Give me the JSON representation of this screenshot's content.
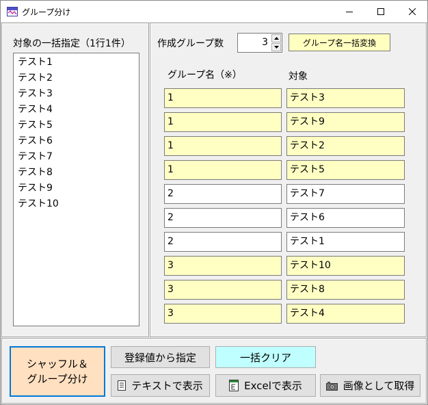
{
  "window": {
    "title": "グループ分け"
  },
  "left_panel": {
    "label": "対象の一括指定（1行1件）",
    "items": [
      "テスト1",
      "テスト2",
      "テスト3",
      "テスト4",
      "テスト5",
      "テスト6",
      "テスト7",
      "テスト8",
      "テスト9",
      "テスト10"
    ]
  },
  "right_panel": {
    "group_count_label": "作成グループ数",
    "group_count_value": "3",
    "rename_button": "グループ名一括変換",
    "col_group": "グループ名（※）",
    "col_target": "対象",
    "rows": [
      {
        "group": "1",
        "target": "テスト3",
        "highlight": true
      },
      {
        "group": "1",
        "target": "テスト9",
        "highlight": true
      },
      {
        "group": "1",
        "target": "テスト2",
        "highlight": true
      },
      {
        "group": "1",
        "target": "テスト5",
        "highlight": true
      },
      {
        "group": "2",
        "target": "テスト7",
        "highlight": false
      },
      {
        "group": "2",
        "target": "テスト6",
        "highlight": false
      },
      {
        "group": "2",
        "target": "テスト1",
        "highlight": false
      },
      {
        "group": "3",
        "target": "テスト10",
        "highlight": true
      },
      {
        "group": "3",
        "target": "テスト8",
        "highlight": true
      },
      {
        "group": "3",
        "target": "テスト4",
        "highlight": true
      }
    ]
  },
  "bottom": {
    "shuffle_line1": "シャッフル＆",
    "shuffle_line2": "グループ分け",
    "registered_button": "登録値から指定",
    "clear_button": "一括クリア",
    "text_button": "テキストで表示",
    "excel_button": "Excelで表示",
    "image_button": "画像として取得"
  },
  "colors": {
    "highlight": "#ffffc4",
    "shuffle": "#ffe0c0",
    "clear": "#c0ffff",
    "focus": "#0078d7"
  }
}
